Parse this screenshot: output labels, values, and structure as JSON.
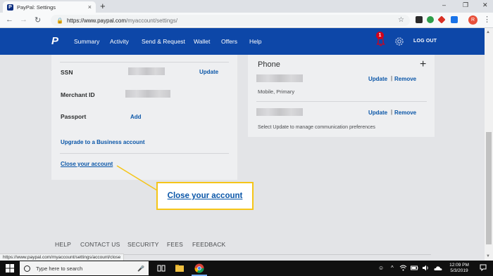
{
  "browser": {
    "tab_title": "PayPal: Settings",
    "tab_favicon": "P",
    "close_glyph": "×",
    "newtab_glyph": "+",
    "minimize_glyph": "–",
    "maximize_glyph": "❐",
    "window_close_glyph": "✕",
    "back_glyph": "←",
    "forward_glyph": "→",
    "reload_glyph": "↻",
    "lock_glyph": "🔒",
    "url_host": "https://www.paypal.com",
    "url_path": "/myaccount/settings/",
    "star_glyph": "☆",
    "profile_initial": "R",
    "kebab_glyph": "⋮"
  },
  "nav": {
    "logo": "P",
    "links": [
      "Summary",
      "Activity",
      "Send & Request",
      "Wallet",
      "Offers",
      "Help"
    ],
    "notification_count": "1",
    "logout": "LOG OUT"
  },
  "left_card": {
    "ssn_label": "SSN",
    "ssn_action": "Update",
    "merchant_label": "Merchant ID",
    "passport_label": "Passport",
    "passport_action": "Add",
    "upgrade_link": "Upgrade to a Business account",
    "close_link": "Close your account"
  },
  "right_card": {
    "title": "Phone",
    "add_glyph": "+",
    "phone1_type": "Mobile, Primary",
    "update": "Update",
    "separator": "|",
    "remove": "Remove",
    "note": "Select Update to manage communication preferences"
  },
  "callout": {
    "text": "Close your account"
  },
  "footer": {
    "links": [
      "HELP",
      "CONTACT US",
      "SECURITY",
      "FEES",
      "FEEDBACK"
    ]
  },
  "scroll": {
    "up_glyph": "▲",
    "down_glyph": "▼"
  },
  "status_url": "https://www.paypal.com/myaccount/settings/account/close",
  "taskbar": {
    "search_placeholder": "Type here to search",
    "mic_glyph": "🎤",
    "people_glyph": "☺",
    "chevron_glyph": "^",
    "time": "12:09 PM",
    "date": "5/3/2019"
  },
  "colors": {
    "paypal_blue": "#0d47a8",
    "link_blue": "#0a56a8",
    "callout_border": "#f5c518",
    "badge_red": "#d0021b"
  }
}
